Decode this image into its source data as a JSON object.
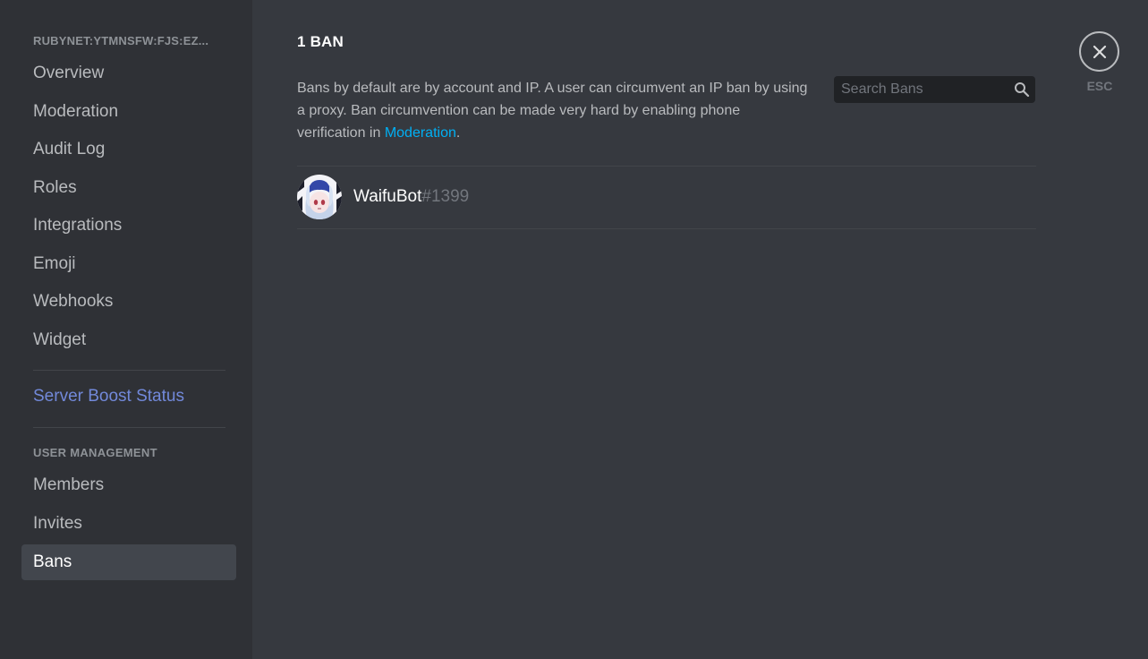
{
  "sidebar": {
    "server_name": "RUBYNET:YTMNSFW:FJS:EZ...",
    "items": [
      {
        "label": "Overview"
      },
      {
        "label": "Moderation"
      },
      {
        "label": "Audit Log"
      },
      {
        "label": "Roles"
      },
      {
        "label": "Integrations"
      },
      {
        "label": "Emoji"
      },
      {
        "label": "Webhooks"
      },
      {
        "label": "Widget"
      }
    ],
    "boost_label": "Server Boost Status",
    "user_management_header": "USER MANAGEMENT",
    "user_items": [
      {
        "label": "Members"
      },
      {
        "label": "Invites"
      },
      {
        "label": "Bans",
        "selected": true
      }
    ]
  },
  "main": {
    "title": "1 BAN",
    "description_prefix": "Bans by default are by account and IP. A user can circumvent an IP ban by using a proxy. Ban circumvention can be made very hard by enabling phone verification in ",
    "description_link": "Moderation",
    "description_suffix": ".",
    "search": {
      "placeholder": "Search Bans",
      "value": ""
    },
    "bans": [
      {
        "username": "WaifuBot",
        "discriminator": "#1399"
      }
    ]
  },
  "close": {
    "esc_label": "ESC"
  },
  "colors": {
    "sidebar_bg": "#2f3136",
    "content_bg": "#36393f",
    "selected_bg": "#42464d",
    "blurple": "#7289da",
    "link": "#00b0f4"
  }
}
